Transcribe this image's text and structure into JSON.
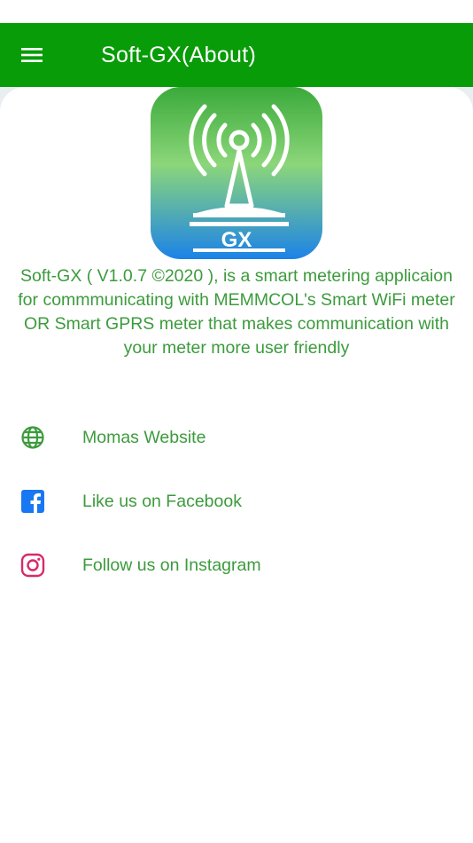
{
  "app_bar": {
    "title": "Soft-GX(About)",
    "background_color": "#089c08",
    "menu_icon": "hamburger-menu-icon"
  },
  "logo": {
    "text": "GX",
    "icon": "radio-antenna-icon",
    "gradient_colors": [
      "#3aaa3a",
      "#8cd67a",
      "#1b83e8"
    ]
  },
  "about": {
    "description": "Soft-GX ( V1.0.7 ©2020 ), is a smart metering applicaion for commmunicating with MEMMCOL's Smart WiFi meter OR Smart GPRS meter that makes communication with your meter more user friendly",
    "text_color": "#3c9b3c"
  },
  "links": [
    {
      "label": "Momas Website",
      "icon": "globe-icon",
      "icon_color": "#3c9b3c"
    },
    {
      "label": "Like us on Facebook",
      "icon": "facebook-icon",
      "icon_color": "#1877f2"
    },
    {
      "label": "Follow us on Instagram",
      "icon": "instagram-icon",
      "icon_color": "#d62a6a"
    }
  ]
}
